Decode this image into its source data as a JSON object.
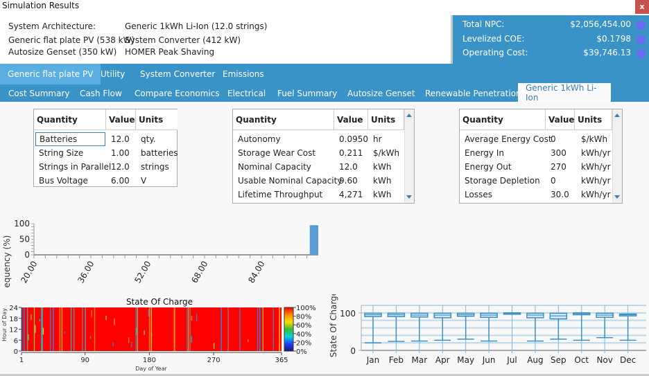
{
  "window": {
    "title": "Simulation Results",
    "close_label": "x"
  },
  "architecture": {
    "label": "System Architecture:",
    "items": [
      "Generic 1kWh Li-Ion (12.0 strings)",
      "Generic flat plate PV (538 kW)",
      "System Converter (412 kW)",
      "Autosize Genset (350 kW)",
      "HOMER Peak Shaving"
    ]
  },
  "summary": [
    {
      "label": "Total NPC:",
      "value": "$2,056,454.00"
    },
    {
      "label": "Levelized COE:",
      "value": "$0.1798"
    },
    {
      "label": "Operating Cost:",
      "value": "$39,746.13"
    }
  ],
  "tabs_row1": [
    "Generic flat plate PV",
    "Utility",
    "System Converter",
    "Emissions"
  ],
  "tabs_row2": [
    "Cost Summary",
    "Cash Flow",
    "Compare Economics",
    "Electrical",
    "Fuel Summary",
    "Autosize Genset",
    "Renewable Penetration",
    "Generic 1kWh Li-Ion"
  ],
  "selected_tab": "Generic 1kWh Li-Ion",
  "table1": {
    "headers": [
      "Quantity",
      "Value",
      "Units"
    ],
    "rows": [
      [
        "Batteries",
        "12.0",
        "qty."
      ],
      [
        "String Size",
        "1.00",
        "batteries"
      ],
      [
        "Strings in Parallel",
        "12.0",
        "strings"
      ],
      [
        "Bus Voltage",
        "6.00",
        "V"
      ]
    ]
  },
  "table2": {
    "headers": [
      "Quantity",
      "Value",
      "Units"
    ],
    "rows": [
      [
        "Autonomy",
        "0.0950",
        "hr"
      ],
      [
        "Storage Wear Cost",
        "0.211",
        "$/kWh"
      ],
      [
        "Nominal Capacity",
        "12.0",
        "kWh"
      ],
      [
        "Usable Nominal Capacity",
        "9.60",
        "kWh"
      ],
      [
        "Lifetime Throughput",
        "4,271",
        "kWh"
      ]
    ]
  },
  "table3": {
    "headers": [
      "Quantity",
      "Value",
      "Units"
    ],
    "rows": [
      [
        "Average Energy Cost",
        "0",
        "$/kWh"
      ],
      [
        "Energy In",
        "300",
        "kWh/yr"
      ],
      [
        "Energy Out",
        "270",
        "kWh/yr"
      ],
      [
        "Storage Depletion",
        "0",
        "kWh/yr"
      ],
      [
        "Losses",
        "30.0",
        "kWh/yr"
      ]
    ]
  },
  "chart_data": [
    {
      "type": "bar",
      "title": "",
      "ylabel": "Frequency (%)",
      "xlabel": "",
      "xticks": [
        "20.00",
        "36.00",
        "52.00",
        "68.00",
        "84.00"
      ],
      "xlim": [
        20,
        100
      ],
      "ylim": [
        0,
        100
      ],
      "yticks": [
        "0",
        "50",
        "100"
      ],
      "bins": [
        {
          "x_start": 98,
          "x_end": 100,
          "value": 95
        }
      ],
      "color": "#5b9bd5"
    },
    {
      "type": "heatmap",
      "title": "State Of Charge",
      "xlabel": "Day of Year",
      "ylabel": "Hour of Day",
      "xticks": [
        "1",
        "90",
        "180",
        "270",
        "365"
      ],
      "yticks": [
        "0",
        "6",
        "12",
        "18",
        "24"
      ],
      "colorbar_ticks": [
        "0%",
        "20%",
        "40%",
        "60%",
        "80%",
        "100%"
      ],
      "dominant_value_percent": 100
    },
    {
      "type": "boxplot",
      "title": "",
      "ylabel": "State Of Charge",
      "categories": [
        "Jan",
        "Feb",
        "Mar",
        "Apr",
        "May",
        "Jun",
        "Jul",
        "Aug",
        "Sep",
        "Oct",
        "Nov",
        "Dec"
      ],
      "yticks": [
        "0",
        "100"
      ],
      "ylim": [
        0,
        120
      ],
      "series": [
        {
          "name": "min",
          "values": [
            20,
            24,
            25,
            27,
            30,
            25,
            100,
            25,
            30,
            27,
            34,
            27
          ]
        },
        {
          "name": "q1",
          "values": [
            90,
            90,
            89,
            87,
            91,
            88,
            98,
            87,
            84,
            95,
            88,
            92
          ]
        },
        {
          "name": "median",
          "values": [
            95,
            95,
            94,
            94,
            95,
            94,
            99,
            94,
            92,
            98,
            94,
            95
          ]
        },
        {
          "name": "q3",
          "values": [
            99,
            99,
            99,
            99,
            99,
            99,
            100,
            99,
            99,
            100,
            99,
            97
          ]
        },
        {
          "name": "max",
          "values": [
            100,
            100,
            100,
            100,
            100,
            100,
            100,
            100,
            100,
            100,
            100,
            100
          ]
        }
      ]
    }
  ]
}
